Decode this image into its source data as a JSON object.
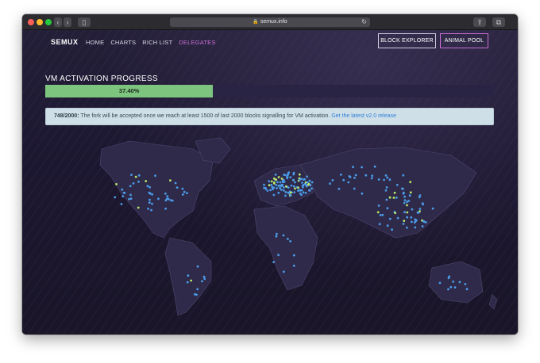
{
  "browser": {
    "url": "semux.info",
    "back_icon": "chevron-left-icon",
    "forward_icon": "chevron-right-icon",
    "sidebar_icon": "sidebar-icon",
    "share_icon": "share-icon",
    "tabs_icon": "tabs-icon"
  },
  "header": {
    "logo": "SEMUX",
    "nav": [
      {
        "label": "HOME"
      },
      {
        "label": "CHARTS"
      },
      {
        "label": "RICH LIST"
      },
      {
        "label": "DELEGATES",
        "active": true
      }
    ],
    "buttons": {
      "explorer": "BLOCK EXPLORER",
      "pool": "ANIMAL POOL"
    }
  },
  "progress": {
    "title": "VM ACTIVATION PROGRESS",
    "value_label": "37.40%",
    "value": 37.4,
    "color": "#7dc47f"
  },
  "alert": {
    "count": "748/2000:",
    "message": " The fork will be accepted once we reach at least 1500 of last 2000 blocks signalling for VM activation. ",
    "link": "Get the latest v2.0 release"
  },
  "map": {
    "legend_colors": {
      "node": "#4a9be8",
      "signalling": "#b9e86a"
    }
  }
}
